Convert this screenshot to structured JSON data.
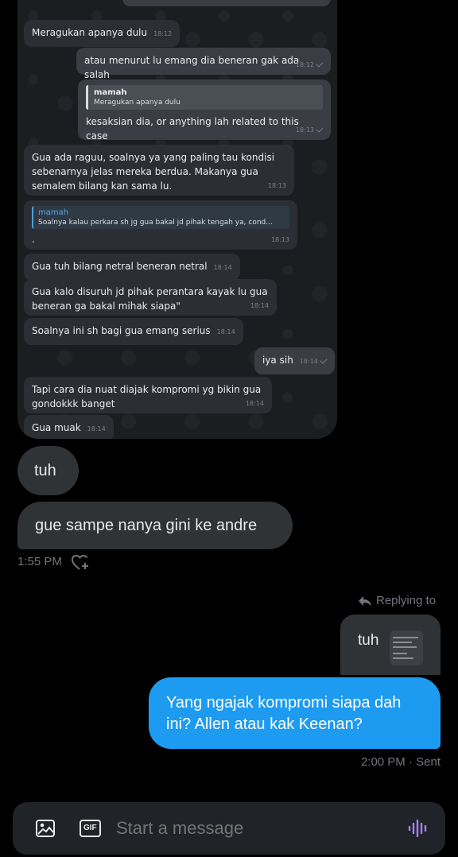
{
  "telegram_screenshot": {
    "messages": [
      {
        "id": "m1",
        "direction": "in",
        "text": "Meragukan apanya dulu",
        "time": "18:12"
      },
      {
        "id": "m2",
        "direction": "out",
        "text": "atau menurut lu emang dia beneran gak ada salah",
        "time": "18:12"
      },
      {
        "id": "m3",
        "direction": "out",
        "quote_name": "mamah",
        "quote_text": "Meragukan apanya dulu",
        "text": "kesaksian dia, or anything lah related to this case",
        "time": "18:13"
      },
      {
        "id": "m4",
        "direction": "in",
        "lines": [
          "Gua ada raguu, soalnya ya yang paling tau kondisi",
          "sebenarnya jelas mereka berdua. Makanya gua",
          "semalem bilang kan sama lu."
        ],
        "time": "18:13"
      },
      {
        "id": "m5",
        "direction": "in",
        "quote_name": "mamah",
        "quote_text": "Soalnya kalau perkara sh jg gua bakal jd pihak tengah ya, cond...",
        "text": ".",
        "time": "18:13"
      },
      {
        "id": "m6",
        "direction": "in",
        "text": "Gua tuh bilang netral beneran netral",
        "time": "18:14"
      },
      {
        "id": "m7",
        "direction": "in",
        "lines": [
          "Gua kalo disuruh jd pihak perantara kayak lu gua",
          "beneran ga bakal mihak siapa\""
        ],
        "time": "18:14"
      },
      {
        "id": "m8",
        "direction": "in",
        "text": "Soalnya ini sh bagi gua emang serius",
        "time": "18:14"
      },
      {
        "id": "m9",
        "direction": "out",
        "text": "iya sih",
        "time": "18:14"
      },
      {
        "id": "m10",
        "direction": "in",
        "lines": [
          "Tapi cara dia nuat diajak kompromi yg bikin gua",
          "gondokkk banget"
        ],
        "time": "18:14"
      },
      {
        "id": "m11",
        "direction": "in",
        "text": "Gua muak",
        "time": "18:14"
      }
    ]
  },
  "dm": {
    "received": [
      {
        "text": "tuh"
      },
      {
        "text": "gue sampe nanya gini ke andre"
      }
    ],
    "received_time": "1:55 PM",
    "replying_to_label": "Replying to",
    "reply_preview_text": "tuh",
    "sent_text": "Yang ngajak kompromi siapa dah ini? Allen atau kak Keenan?",
    "sent_meta": "2:00 PM · Sent"
  },
  "composer": {
    "placeholder": "Start a message",
    "gif_label": "GIF"
  },
  "colors": {
    "accent": "#1d9bf0",
    "bubble_received": "#2f3336",
    "meta_text": "#71767b"
  },
  "icons": [
    "reaction-heart-add-icon",
    "reply-arrow-icon",
    "image-icon",
    "gif-icon",
    "voice-waveform-icon",
    "read-tick-icon"
  ]
}
